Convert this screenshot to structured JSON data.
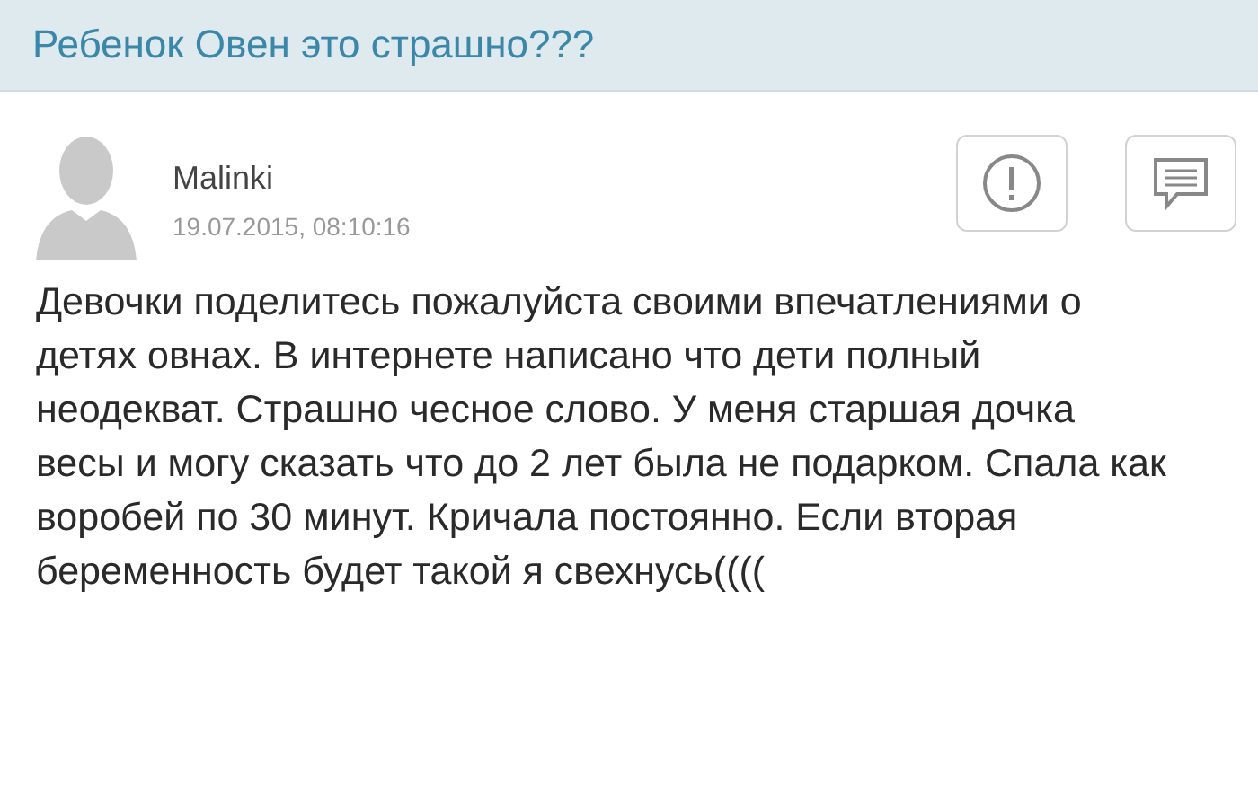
{
  "header": {
    "title": "Ребенок Овен это страшно???"
  },
  "post": {
    "author": "Malinki",
    "date": "19.07.2015, 08:10:16",
    "text": "Девочки поделитесь пожалуйста своими впечатлениями о детях овнах. В интернете написано что дети полный неодекват. Страшно чесное слово. У меня старшая дочка весы и могу сказать что до 2 лет была не подарком. Спала как воробей по 30 минут. Кричала постоянно. Если вторая беременность будет такой я свехнусь(((("
  }
}
